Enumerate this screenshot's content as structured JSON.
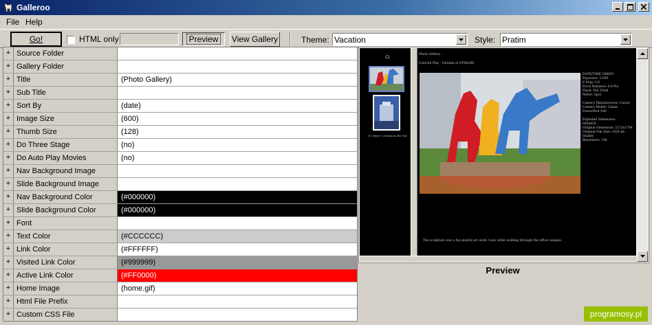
{
  "window": {
    "title": "Galleroo"
  },
  "menu": [
    "File",
    "Help"
  ],
  "toolbar": {
    "go_label": "Go!",
    "html_only_label": "HTML only",
    "preview_label": "Preview",
    "view_gallery_label": "View Gallery",
    "theme_label": "Theme:",
    "theme_value": "Vacation",
    "style_label": "Style:",
    "style_value": "Pratim"
  },
  "properties": [
    {
      "name": "Source Folder",
      "value": ""
    },
    {
      "name": "Gallery Folder",
      "value": ""
    },
    {
      "name": "Title",
      "value": "(Photo Gallery)"
    },
    {
      "name": "Sub Title",
      "value": ""
    },
    {
      "name": "Sort By",
      "value": "(date)"
    },
    {
      "name": "Image Size",
      "value": "(600)"
    },
    {
      "name": "Thumb Size",
      "value": "(128)"
    },
    {
      "name": "Do Three Stage",
      "value": "(no)"
    },
    {
      "name": "Do Auto Play Movies",
      "value": "(no)"
    },
    {
      "name": "Nav Background Image",
      "value": ""
    },
    {
      "name": "Slide Background Image",
      "value": ""
    },
    {
      "name": "Nav Background Color",
      "value": "(#000000)",
      "bg": "#000000",
      "fg": "#ffffff"
    },
    {
      "name": "Slide Background Color",
      "value": "(#000000)",
      "bg": "#000000",
      "fg": "#ffffff"
    },
    {
      "name": "Font",
      "value": ""
    },
    {
      "name": "Text Color",
      "value": "(#CCCCCC)",
      "bg": "#cccccc",
      "fg": "#000000"
    },
    {
      "name": "Link Color",
      "value": "(#FFFFFF)",
      "bg": "#ffffff",
      "fg": "#000000"
    },
    {
      "name": "Visited Link Color",
      "value": "(#999999)",
      "bg": "#999999",
      "fg": "#000000"
    },
    {
      "name": "Active Link Color",
      "value": "(#FF0000)",
      "bg": "#ff0000",
      "fg": "#ffffff"
    },
    {
      "name": "Home Image",
      "value": "(home.gif)"
    },
    {
      "name": "Html File Prefix",
      "value": ""
    },
    {
      "name": "Custom CSS File",
      "value": ""
    }
  ],
  "preview": {
    "caption": "Preview",
    "page_title": "Photo Gallery -",
    "photo_title": "Colorful Play - Outside of STMicRD",
    "thumb_caption": "(1) Item 1 of Item in the Set",
    "exif_lines": [
      "DATE/TIME TAKEN",
      "Exposure: 1/160",
      "F-Stop: 5.6",
      "Focal Distance: 4.8 Pix",
      "Flash: Not Fired",
      "Meter: Spot",
      "",
      "Camera Manufacturer: Canon",
      "Camera Model: Canon",
      "PowerShot S40",
      "",
      "Exploded Dimension:",
      "600x450",
      "Original Dimension: 2272x1704",
      "Original File Size: 1024 kb",
      "Quality",
      "Resolution: 180"
    ],
    "photo_note": "The sculpture was a fun playful art work I saw while walking through the office campus.",
    "home_glyph": "⌂",
    "photo_colors": {
      "sky": "#d8dde2",
      "red": "#d01c24",
      "yellow": "#f0b020",
      "blue": "#3a78c8",
      "grass": "#5a8a3a"
    }
  },
  "watermark": "programosy.pl",
  "icons": {
    "app": "dog-icon",
    "minimize": "minimize-icon",
    "maximize": "maximize-icon",
    "close": "close-icon"
  }
}
